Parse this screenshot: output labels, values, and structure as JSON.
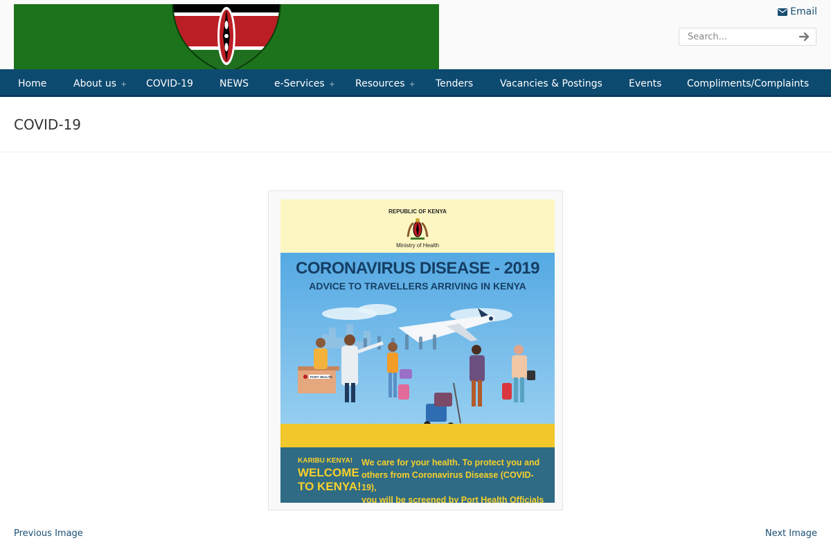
{
  "header": {
    "email_label": "Email",
    "search": {
      "placeholder": "Search...",
      "value": ""
    }
  },
  "nav": {
    "items": [
      {
        "label": "Home",
        "has_submenu": false
      },
      {
        "label": "About us",
        "has_submenu": true
      },
      {
        "label": "COVID-19",
        "has_submenu": false
      },
      {
        "label": "NEWS",
        "has_submenu": false
      },
      {
        "label": "e-Services",
        "has_submenu": true
      },
      {
        "label": "Resources",
        "has_submenu": true
      },
      {
        "label": "Tenders",
        "has_submenu": false
      },
      {
        "label": "Vacancies & Postings",
        "has_submenu": false
      },
      {
        "label": "Events",
        "has_submenu": false
      },
      {
        "label": "Compliments/Complaints",
        "has_submenu": false
      }
    ],
    "submenu_indicator": "+"
  },
  "page": {
    "title": "COVID-19"
  },
  "poster": {
    "republic": "REPUBLIC OF KENYA",
    "ministry": "Ministry of Health",
    "title": "CORONAVIRUS DISEASE - 2019",
    "subtitle": "ADVICE TO TRAVELLERS ARRIVING IN KENYA",
    "desk_sign": "PORT HEALTH",
    "karibu": "KARIBU KENYA!",
    "welcome_line1": "WELCOME",
    "welcome_line2": "TO KENYA!",
    "care_line1": "We care for your health. To protect you and",
    "care_line2": "others from Coronavirus Disease (COVID-19),",
    "care_line3": "you will be screened by Port Health Officials"
  },
  "gallery": {
    "previous_label": "Previous Image",
    "next_label": "Next Image"
  },
  "colors": {
    "nav_bg": "#0d4a70",
    "link": "#1a4e72",
    "logo_green": "#1d731b",
    "poster_blue": "#55a9e3",
    "poster_yellow": "#f7d02c",
    "poster_teal": "#2f6b84"
  }
}
